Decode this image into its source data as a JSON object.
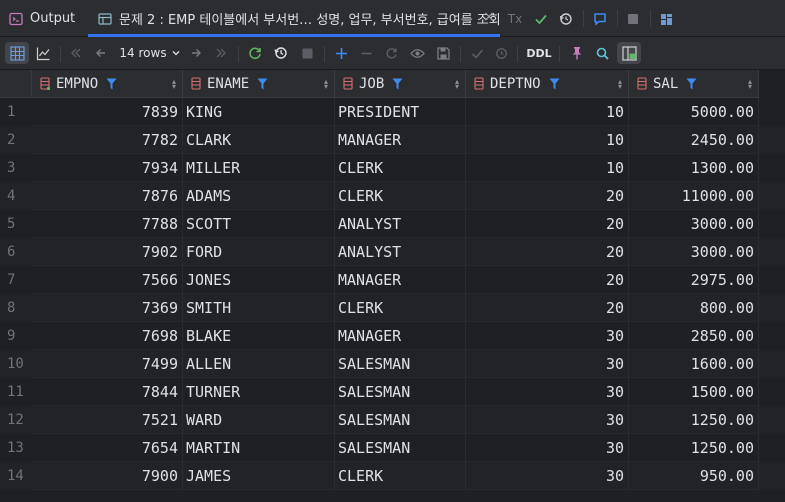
{
  "tabs": {
    "output_label": "Output",
    "query_label": "문제 2 : EMP 테이블에서 부서번… 성명, 업무, 부서번호, 급여를 조회",
    "close_glyph": "×",
    "tx_label": "Tx"
  },
  "toolbar": {
    "rows_label": "14 rows",
    "ddl_label": "DDL"
  },
  "columns": [
    {
      "name": "EMPNO"
    },
    {
      "name": "ENAME"
    },
    {
      "name": "JOB"
    },
    {
      "name": "DEPTNO"
    },
    {
      "name": "SAL"
    }
  ],
  "rows": [
    {
      "n": "1",
      "empno": "7839",
      "ename": "KING",
      "job": "PRESIDENT",
      "deptno": "10",
      "sal": "5000.00"
    },
    {
      "n": "2",
      "empno": "7782",
      "ename": "CLARK",
      "job": "MANAGER",
      "deptno": "10",
      "sal": "2450.00"
    },
    {
      "n": "3",
      "empno": "7934",
      "ename": "MILLER",
      "job": "CLERK",
      "deptno": "10",
      "sal": "1300.00"
    },
    {
      "n": "4",
      "empno": "7876",
      "ename": "ADAMS",
      "job": "CLERK",
      "deptno": "20",
      "sal": "11000.00"
    },
    {
      "n": "5",
      "empno": "7788",
      "ename": "SCOTT",
      "job": "ANALYST",
      "deptno": "20",
      "sal": "3000.00"
    },
    {
      "n": "6",
      "empno": "7902",
      "ename": "FORD",
      "job": "ANALYST",
      "deptno": "20",
      "sal": "3000.00"
    },
    {
      "n": "7",
      "empno": "7566",
      "ename": "JONES",
      "job": "MANAGER",
      "deptno": "20",
      "sal": "2975.00"
    },
    {
      "n": "8",
      "empno": "7369",
      "ename": "SMITH",
      "job": "CLERK",
      "deptno": "20",
      "sal": "800.00"
    },
    {
      "n": "9",
      "empno": "7698",
      "ename": "BLAKE",
      "job": "MANAGER",
      "deptno": "30",
      "sal": "2850.00"
    },
    {
      "n": "10",
      "empno": "7499",
      "ename": "ALLEN",
      "job": "SALESMAN",
      "deptno": "30",
      "sal": "1600.00"
    },
    {
      "n": "11",
      "empno": "7844",
      "ename": "TURNER",
      "job": "SALESMAN",
      "deptno": "30",
      "sal": "1500.00"
    },
    {
      "n": "12",
      "empno": "7521",
      "ename": "WARD",
      "job": "SALESMAN",
      "deptno": "30",
      "sal": "1250.00"
    },
    {
      "n": "13",
      "empno": "7654",
      "ename": "MARTIN",
      "job": "SALESMAN",
      "deptno": "30",
      "sal": "1250.00"
    },
    {
      "n": "14",
      "empno": "7900",
      "ename": "JAMES",
      "job": "CLERK",
      "deptno": "30",
      "sal": "950.00"
    }
  ],
  "colors": {
    "accent": "#3574f0",
    "filter_icon": "#3d8bf0",
    "column_icon": "#d96f6f",
    "success": "#5fb865"
  }
}
